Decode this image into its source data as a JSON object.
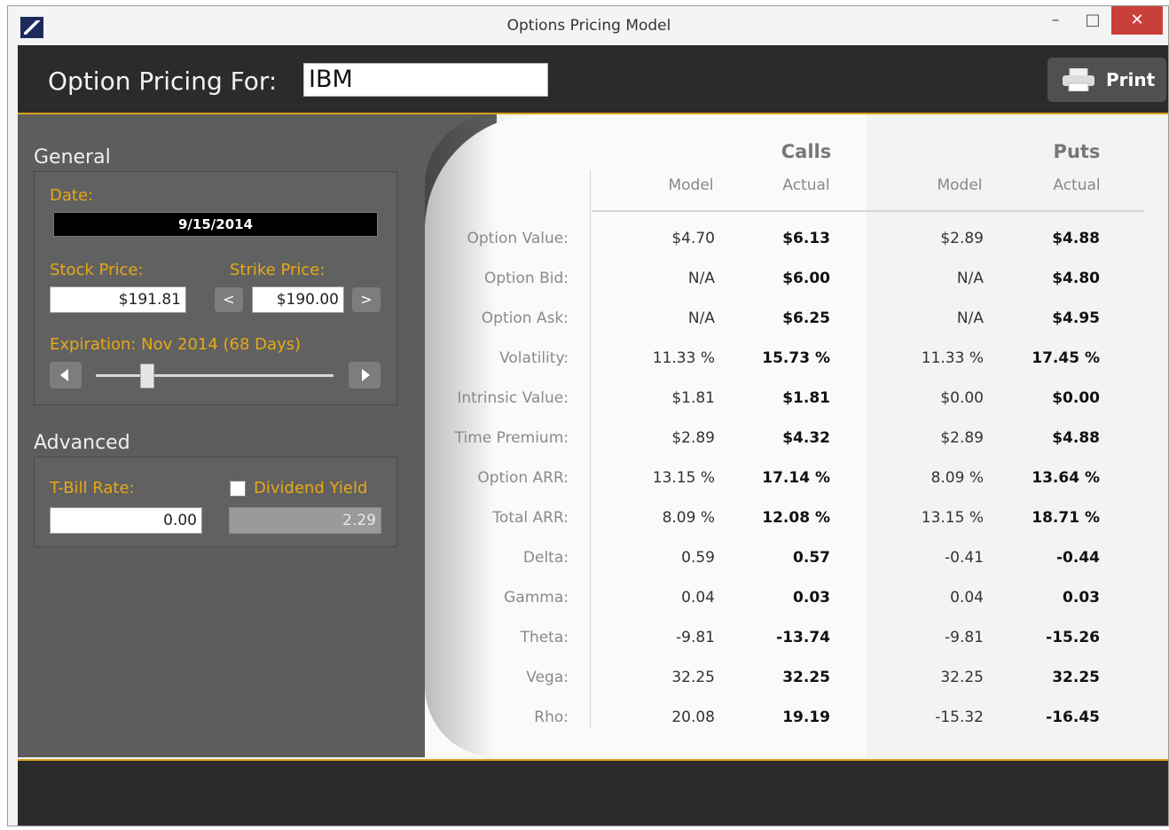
{
  "window": {
    "title": "Options Pricing Model",
    "minimize": "–",
    "maximize": "□",
    "close": "✕"
  },
  "header": {
    "label": "Option Pricing For:",
    "symbol": "IBM",
    "print_label": "Print"
  },
  "general": {
    "title": "General",
    "date_label": "Date:",
    "date_value": "9/15/2014",
    "stock_price_label": "Stock Price:",
    "stock_price": "$191.81",
    "strike_price_label": "Strike Price:",
    "strike_price": "$190.00",
    "strike_prev": "<",
    "strike_next": ">",
    "expiration_label": "Expiration: Nov 2014 (68 Days)",
    "expiration_slider_fraction": 0.2
  },
  "advanced": {
    "title": "Advanced",
    "tbill_label": "T-Bill Rate:",
    "tbill_value": "0.00",
    "dividend_label": "Dividend Yield",
    "dividend_checked": false,
    "dividend_value": "2.29"
  },
  "table": {
    "groups": [
      "Calls",
      "Puts"
    ],
    "subheaders": [
      "Model",
      "Actual",
      "Model",
      "Actual"
    ],
    "rows": [
      {
        "label": "Option Value:",
        "values": [
          "$4.70",
          "$6.13",
          "$2.89",
          "$4.88"
        ]
      },
      {
        "label": "Option Bid:",
        "values": [
          "N/A",
          "$6.00",
          "N/A",
          "$4.80"
        ]
      },
      {
        "label": "Option Ask:",
        "values": [
          "N/A",
          "$6.25",
          "N/A",
          "$4.95"
        ]
      },
      {
        "label": "Volatility:",
        "values": [
          "11.33 %",
          "15.73 %",
          "11.33 %",
          "17.45 %"
        ]
      },
      {
        "label": "Intrinsic Value:",
        "values": [
          "$1.81",
          "$1.81",
          "$0.00",
          "$0.00"
        ]
      },
      {
        "label": "Time Premium:",
        "values": [
          "$2.89",
          "$4.32",
          "$2.89",
          "$4.88"
        ]
      },
      {
        "label": "Option ARR:",
        "values": [
          "13.15 %",
          "17.14 %",
          "8.09 %",
          "13.64 %"
        ]
      },
      {
        "label": "Total ARR:",
        "values": [
          "8.09 %",
          "12.08 %",
          "13.15 %",
          "18.71 %"
        ]
      },
      {
        "label": "Delta:",
        "values": [
          "0.59",
          "0.57",
          "-0.41",
          "-0.44"
        ]
      },
      {
        "label": "Gamma:",
        "values": [
          "0.04",
          "0.03",
          "0.04",
          "0.03"
        ]
      },
      {
        "label": "Theta:",
        "values": [
          "-9.81",
          "-13.74",
          "-9.81",
          "-15.26"
        ]
      },
      {
        "label": "Vega:",
        "values": [
          "32.25",
          "32.25",
          "32.25",
          "32.25"
        ]
      },
      {
        "label": "Rho:",
        "values": [
          "20.08",
          "19.19",
          "-15.32",
          "-16.45"
        ]
      }
    ]
  },
  "colors": {
    "accent": "#d9a21a",
    "label_gold": "#e6a817",
    "header_bg": "#2b2b2b",
    "panel_bg": "#5d5d5d",
    "close_red": "#c9403a"
  }
}
